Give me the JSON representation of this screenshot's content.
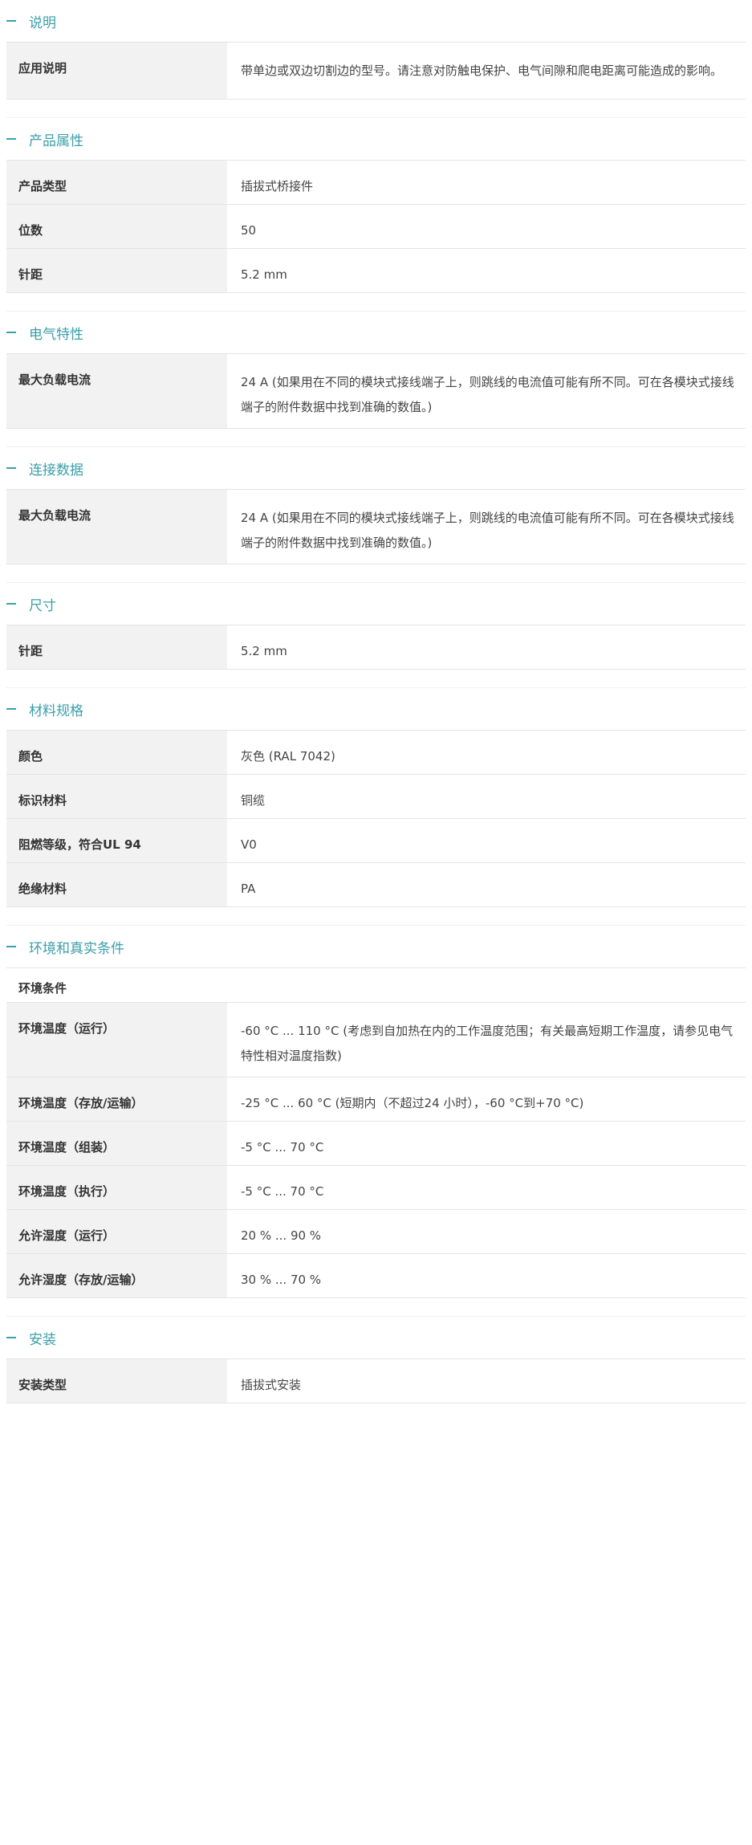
{
  "sections": [
    {
      "title": "说明",
      "rows": [
        {
          "label": "应用说明",
          "value": "带单边或双边切割边的型号。请注意对防触电保护、电气间隙和爬电距离可能造成的影响。"
        }
      ]
    },
    {
      "title": "产品属性",
      "rows": [
        {
          "label": "产品类型",
          "value": "插拔式桥接件"
        },
        {
          "label": "位数",
          "value": "50"
        },
        {
          "label": "针距",
          "value": "5.2 mm"
        }
      ]
    },
    {
      "title": "电气特性",
      "rows": [
        {
          "label": "最大负载电流",
          "value": "24 A (如果用在不同的模块式接线端子上，则跳线的电流值可能有所不同。可在各模块式接线端子的附件数据中找到准确的数值。)"
        }
      ]
    },
    {
      "title": "连接数据",
      "rows": [
        {
          "label": "最大负载电流",
          "value": "24 A (如果用在不同的模块式接线端子上，则跳线的电流值可能有所不同。可在各模块式接线端子的附件数据中找到准确的数值。)"
        }
      ]
    },
    {
      "title": "尺寸",
      "rows": [
        {
          "label": "针距",
          "value": "5.2 mm"
        }
      ]
    },
    {
      "title": "材料规格",
      "rows": [
        {
          "label": "颜色",
          "value": "灰色 (RAL 7042)"
        },
        {
          "label": "标识材料",
          "value": "铜缆"
        },
        {
          "label": "阻燃等级，符合UL 94",
          "value": "V0"
        },
        {
          "label": "绝缘材料",
          "value": "PA"
        }
      ]
    },
    {
      "title": "环境和真实条件",
      "subhead": "环境条件",
      "rows": [
        {
          "label": "环境温度（运行）",
          "value": "-60 °C ... 110 °C (考虑到自加热在内的工作温度范围；有关最高短期工作温度，请参见电气特性相对温度指数)"
        },
        {
          "label": "环境温度（存放/运输）",
          "value": "-25 °C ... 60 °C (短期内（不超过24 小时），-60 °C到+70 °C)"
        },
        {
          "label": "环境温度（组装）",
          "value": "-5 °C ... 70 °C"
        },
        {
          "label": "环境温度（执行）",
          "value": "-5 °C ... 70 °C"
        },
        {
          "label": "允许湿度（运行）",
          "value": "20 % ... 90 %"
        },
        {
          "label": "允许湿度（存放/运输）",
          "value": "30 % ... 70 %"
        }
      ]
    },
    {
      "title": "安装",
      "rows": [
        {
          "label": "安装类型",
          "value": "插拔式安装"
        }
      ]
    }
  ],
  "colors": {
    "accent": "#3a9faa",
    "label_bg": "#f2f2f2",
    "border": "#e4e4e4"
  }
}
